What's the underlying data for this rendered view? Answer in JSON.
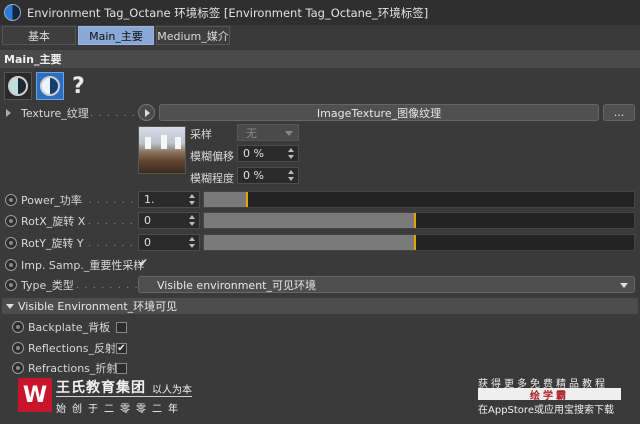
{
  "window": {
    "title": "Environment Tag_Octane 环境标签 [Environment Tag_Octane_环境标签]"
  },
  "tabs": [
    {
      "label": "基本",
      "active": false
    },
    {
      "label": "Main_主要",
      "active": true
    },
    {
      "label": "Medium_媒介",
      "active": false
    }
  ],
  "section": {
    "title": "Main_主要"
  },
  "toolbar": {
    "help_label": "?"
  },
  "texture": {
    "label": "Texture_纹理",
    "dots": ". . . . . . .",
    "value": "ImageTexture_图像纹理",
    "more_label": "...",
    "sampling_label": "采样",
    "sampling_value": "无",
    "blur_offset_label": "模糊偏移",
    "blur_offset_value": "0 %",
    "blur_scale_label": "模糊程度",
    "blur_scale_value": "0 %"
  },
  "params": {
    "power": {
      "label": "Power_功率",
      "dots": ". . . . . . . . . .",
      "value": "1.",
      "fraction": 0.1
    },
    "rotx": {
      "label": "RotX_旋转 X",
      "dots": ". . . . . . . .",
      "value": "0",
      "fraction": 0.49
    },
    "roty": {
      "label": "RotY_旋转 Y",
      "dots": ". . . . . . . .",
      "value": "0",
      "fraction": 0.49
    },
    "imp": {
      "label": "Imp. Samp._重要性采样",
      "checked": "✔"
    },
    "type": {
      "label": "Type_类型",
      "dots": ". . . . . . . . . . .",
      "value": "Visible environment_可见环境"
    }
  },
  "visible_env": {
    "title": "Visible Environment_环境可见",
    "backplate": {
      "label": "Backplate_背板",
      "checked": ""
    },
    "reflections": {
      "label": "Reflections_反射",
      "checked": "✔"
    },
    "refractions": {
      "label": "Refractions_折射",
      "checked": ""
    }
  },
  "watermark": {
    "logo_letter": "W",
    "name": "王氏教育集团",
    "slogan": "以人为本",
    "sub": "始创于二零零二年",
    "promo_line1": "获得更多免费精品教程",
    "promo_badge": "绘学霸",
    "promo_line3": "在AppStore或应用宝搜索下载"
  },
  "colors": {
    "accent": "#8aa8d6",
    "slider_knob": "#e6a400",
    "brand": "#c8152b"
  }
}
